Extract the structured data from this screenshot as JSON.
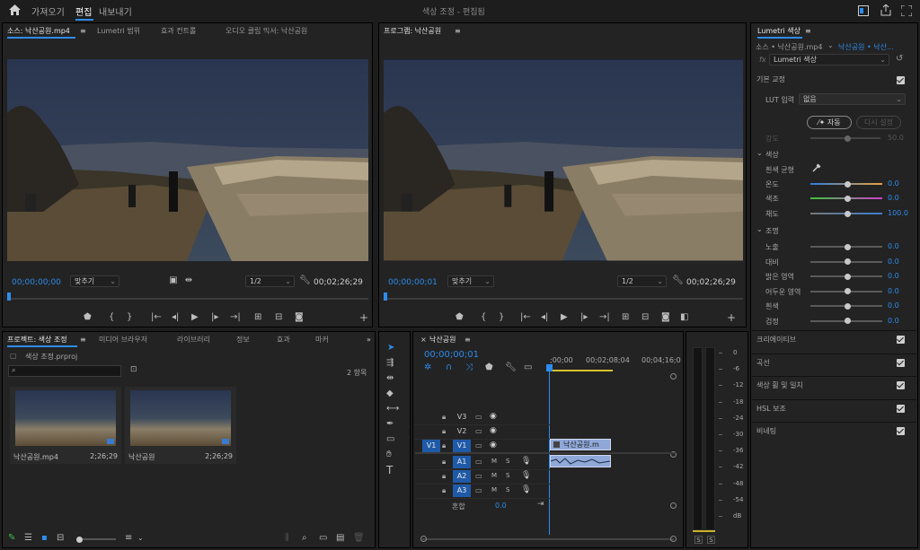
{
  "menu": {
    "import": "가져오기",
    "edit": "편집",
    "export": "내보내기",
    "title": "색상 조정 - 편집됨"
  },
  "source_panel": {
    "tabs": [
      "소스: 낙산공원.mp4",
      "Lumetri 범위",
      "효과 컨트롤",
      "오디오 클립 믹서: 낙산공원"
    ],
    "timecode": "00;00;00;00",
    "fit": "맞추기",
    "quality": "1/2",
    "duration": "00;02;26;29"
  },
  "program_panel": {
    "title": "프로그램: 낙산공원",
    "timecode": "00;00;00;01",
    "fit": "맞추기",
    "quality": "1/2",
    "duration": "00;02;26;29"
  },
  "project_panel": {
    "tabs": [
      "프로젝트: 색상 조정",
      "미디어 브라우저",
      "라이브러리",
      "정보",
      "효과",
      "마커"
    ],
    "file": "색상 조정.prproj",
    "count": "2 항목",
    "items": [
      {
        "name": "낙산공원.mp4",
        "duration": "2;26;29"
      },
      {
        "name": "낙산공원",
        "duration": "2;26;29"
      }
    ]
  },
  "timeline": {
    "title": "낙산공원",
    "timecode": "00;00;00;01",
    "ruler": [
      ";00;00",
      "00;02;08;04",
      "00;04;16;0"
    ],
    "video_tracks": [
      "V3",
      "V2",
      "V1"
    ],
    "audio_tracks": [
      "A1",
      "A2",
      "A3"
    ],
    "source_patch": "V1",
    "master": "혼합",
    "master_value": "0.0",
    "clip_label": "낙산공원.m",
    "track_toggles": {
      "mute": "M",
      "solo": "S"
    }
  },
  "meter": {
    "scale": [
      "0",
      "-6",
      "-12",
      "-18",
      "-24",
      "-30",
      "-36",
      "-42",
      "-48",
      "-54",
      "dB"
    ],
    "solo_left": "S",
    "solo_right": "S"
  },
  "lumetri": {
    "tab": "Lumetri 색상",
    "source": "소스 • 낙산공원.mp4",
    "target": "낙산공원 • 낙산...",
    "fx": "fx",
    "effect": "Lumetri 색상",
    "basic": "기본 교정",
    "lut_label": "LUT 입력",
    "lut_value": "없음",
    "auto": "자동",
    "reset": "다시 설정",
    "strength_label": "강도",
    "strength_value": "50.0",
    "color_section": "색상",
    "wb_label": "흰색 균형",
    "temperature": {
      "label": "온도",
      "value": "0.0"
    },
    "tint": {
      "label": "색조",
      "value": "0.0"
    },
    "saturation": {
      "label": "채도",
      "value": "100.0"
    },
    "light_section": "조명",
    "light": [
      {
        "label": "노출",
        "value": "0.0"
      },
      {
        "label": "대비",
        "value": "0.0"
      },
      {
        "label": "밝은 영역",
        "value": "0.0"
      },
      {
        "label": "어두운 영역",
        "value": "0.0"
      },
      {
        "label": "흰색",
        "value": "0.0"
      },
      {
        "label": "검정",
        "value": "0.0"
      }
    ],
    "sections": [
      "크리에이티브",
      "곡선",
      "색상 휠 및 일치",
      "HSL 보조",
      "비네팅"
    ]
  }
}
